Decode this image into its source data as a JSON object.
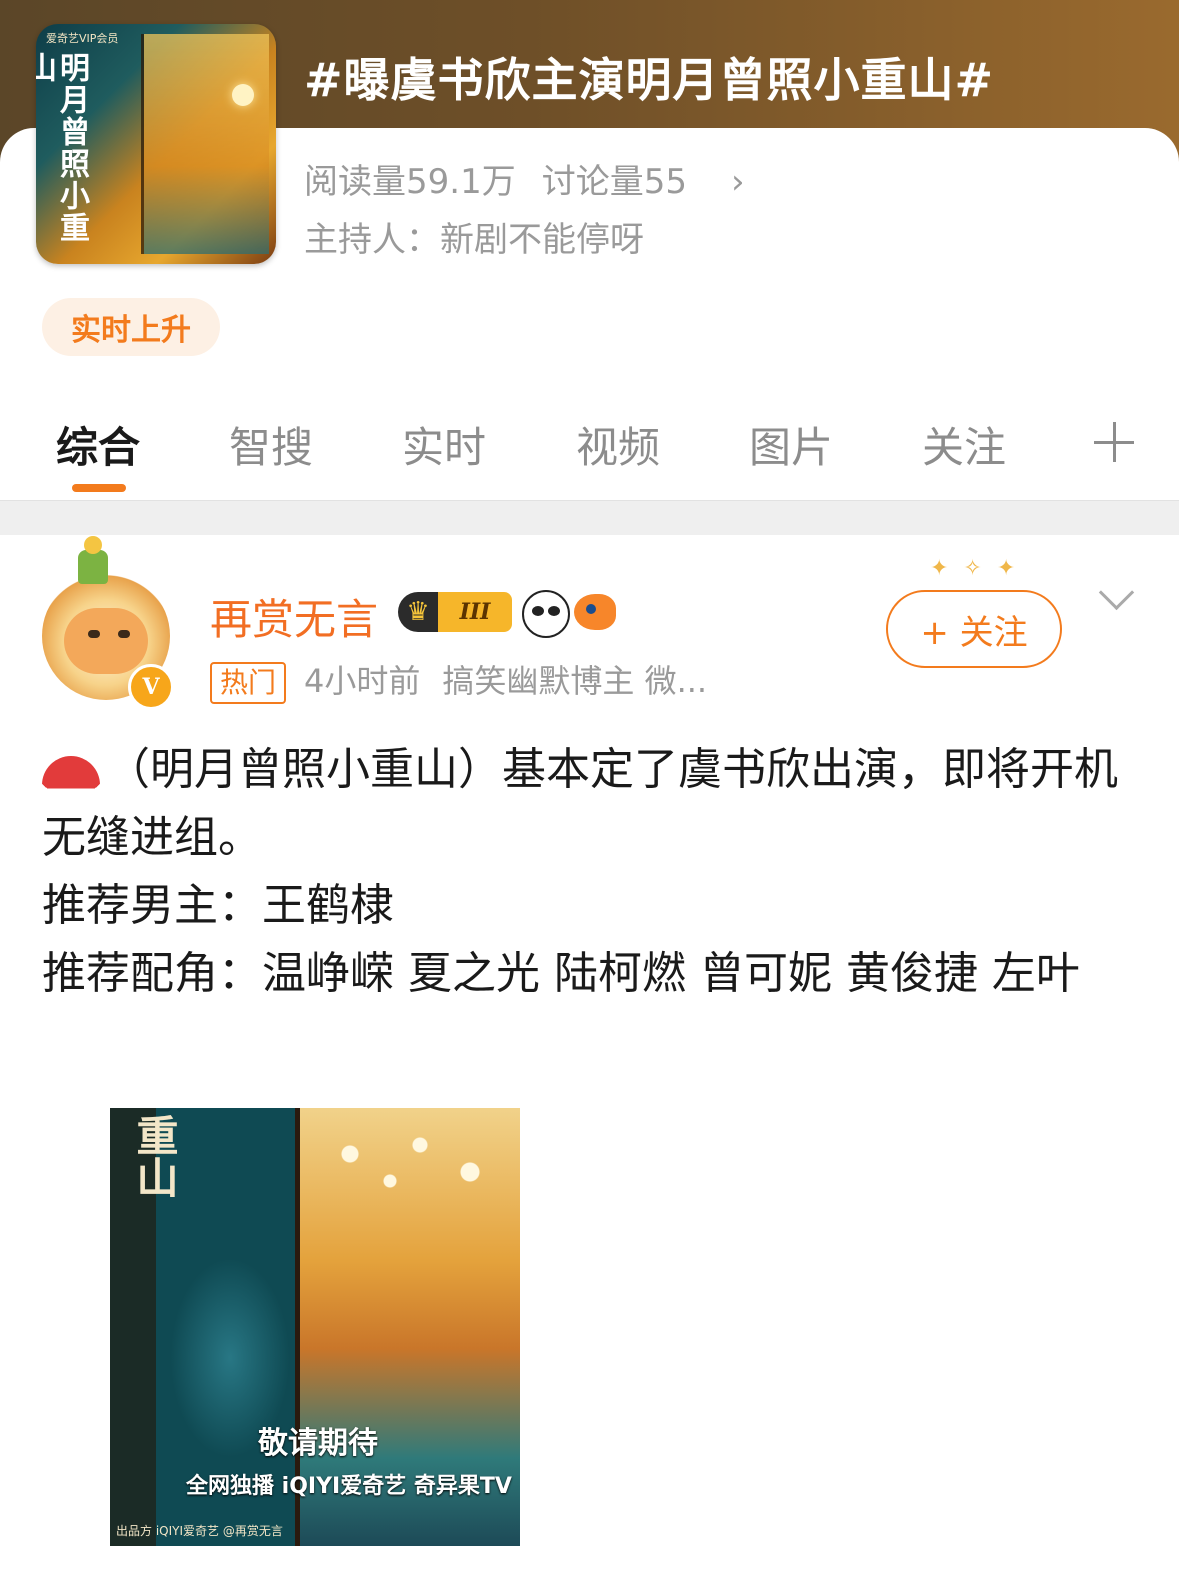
{
  "topic": {
    "title": "#曝虞书欣主演明月曾照小重山#",
    "cover_brand": "爱奇艺VIP会员",
    "cover_title": "明月曾照小重山",
    "reads": "阅读量59.1万",
    "discussions": "讨论量55",
    "host": "主持人：新剧不能停呀",
    "trend_badge": "实时上升"
  },
  "tabs": [
    {
      "label": "综合",
      "active": true
    },
    {
      "label": "智搜",
      "active": false
    },
    {
      "label": "实时",
      "active": false
    },
    {
      "label": "视频",
      "active": false
    },
    {
      "label": "图片",
      "active": false
    },
    {
      "label": "关注",
      "active": false
    }
  ],
  "post": {
    "username": "再赏无言",
    "vip_level": "III",
    "verified_mark": "V",
    "hot_tag": "热门",
    "time": "4小时前",
    "bio": "搞笑幽默博主 微...",
    "follow_label": "+ 关注",
    "text_lines": [
      "（明月曾照小重山）基本定了虞书欣出演，即将开机无缝进组。",
      "推荐男主：王鹤棣",
      "推荐配角：温峥嵘 夏之光 陆柯燃 曾可妮 黄俊捷 左叶"
    ],
    "poster": {
      "title": "重山",
      "coming_soon": "敬请期待",
      "platforms": "全网独播 iQIYI爱奇艺  奇异果TV",
      "credit": "出品方 iQIYI爱奇艺   @再赏无言"
    }
  },
  "colors": {
    "accent": "#f37b1d",
    "username": "#f26e23",
    "header_brown": "#6e4f28"
  },
  "icons": [
    "chevron-right-icon",
    "plus-icon",
    "crown-icon",
    "panda-icon",
    "fish-icon",
    "chevron-down-icon",
    "watermelon-icon",
    "verified-v-icon"
  ]
}
